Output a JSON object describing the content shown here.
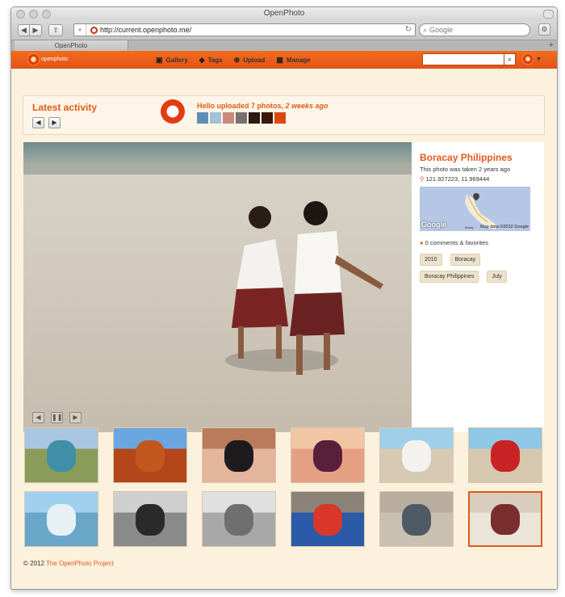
{
  "browser": {
    "window_title": "OpenPhoto",
    "url": "http://current.openphoto.me/",
    "search_placeholder": "Google",
    "tab_label": "OpenPhoto"
  },
  "header": {
    "logo_text": "openphoto",
    "nav": [
      {
        "label": "Gallery",
        "icon": "image-icon"
      },
      {
        "label": "Tags",
        "icon": "tag-icon"
      },
      {
        "label": "Upload",
        "icon": "upload-icon"
      },
      {
        "label": "Manage",
        "icon": "grid-icon"
      }
    ],
    "search_value": ""
  },
  "activity": {
    "title": "Latest activity",
    "text_main": "Hello uploaded 7 photos, ",
    "text_time": "2 weeks ago",
    "thumbs": [
      "#5f8fb8",
      "#9fc2d6",
      "#c98a7b",
      "#7a6f74",
      "#2a1a10",
      "#3a1808",
      "#d94a10"
    ]
  },
  "photo": {
    "title": "Boracay Philippines",
    "taken": "This photo was taken 2 years ago",
    "coords": "121.927223, 11.969444",
    "map": {
      "brand": "Google",
      "attribution": "Map data ©2012 Google",
      "place": "Malay"
    },
    "comments": "0 comments & favorites",
    "tags": [
      "2010",
      "Boracay",
      "Boracay Philippines",
      "July"
    ]
  },
  "thumbnails": [
    {
      "name": "thumb-coast",
      "c1": "#a9c6e0",
      "c2": "#3f8fa8",
      "c3": "#8a9b5a"
    },
    {
      "name": "thumb-red-rock",
      "c1": "#6aa7e0",
      "c2": "#c4571e",
      "c3": "#b5461a"
    },
    {
      "name": "thumb-sunglasses-woman",
      "c1": "#b97b5c",
      "c2": "#1e1a1e",
      "c3": "#e3b59c"
    },
    {
      "name": "thumb-sunglasses-pink",
      "c1": "#f2c5a5",
      "c2": "#5a1f3a",
      "c3": "#e5a084"
    },
    {
      "name": "thumb-boy-beach-white",
      "c1": "#9fd0e8",
      "c2": "#f4f2ee",
      "c3": "#d7c9b2"
    },
    {
      "name": "thumb-boy-beach-red",
      "c1": "#8fc7e5",
      "c2": "#c92325",
      "c3": "#d6c8af"
    },
    {
      "name": "thumb-boy-portrait",
      "c1": "#9fd1ee",
      "c2": "#e6f0f5",
      "c3": "#6aa6c8"
    },
    {
      "name": "thumb-street-bw",
      "c1": "#cfcfcf",
      "c2": "#2a2a2a",
      "c3": "#8a8a8a"
    },
    {
      "name": "thumb-fence-bw",
      "c1": "#e0e0e0",
      "c2": "#6f6f6f",
      "c3": "#a8a8a8"
    },
    {
      "name": "thumb-surfboard",
      "c1": "#8c8378",
      "c2": "#d8372a",
      "c3": "#2a5aa8"
    },
    {
      "name": "thumb-fish",
      "c1": "#b9ad9e",
      "c2": "#4e5b64",
      "c3": "#c9c0b2"
    },
    {
      "name": "thumb-girls-beach",
      "c1": "#d8cdbd",
      "c2": "#7a2d2d",
      "c3": "#ebe4d8",
      "active": true
    }
  ],
  "footer": {
    "copyright": "© 2012 ",
    "link": "The OpenPhoto Project"
  },
  "colors": {
    "accent": "#e35919",
    "header": "#f26c1b",
    "background": "#fbf1dd"
  }
}
